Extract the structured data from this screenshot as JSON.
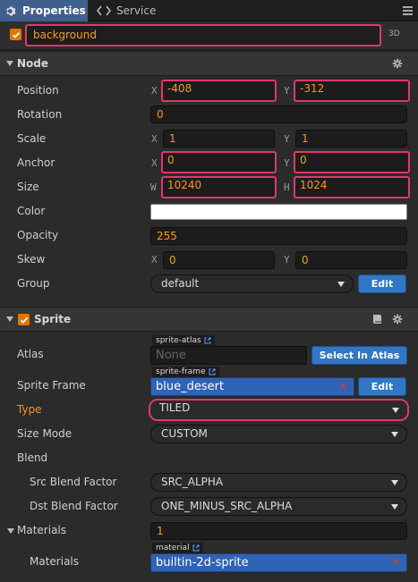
{
  "tabs": [
    {
      "label": "Properties",
      "icon": "gear-icon",
      "active": true
    },
    {
      "label": "Service",
      "icon": "code-icon",
      "active": false
    }
  ],
  "node": {
    "name": "background",
    "enabled": true,
    "mode_3d": "3D"
  },
  "node_section": {
    "title": "Node",
    "position": {
      "label": "Position",
      "x_axis": "X",
      "x": "-408",
      "y_axis": "Y",
      "y": "-312"
    },
    "rotation": {
      "label": "Rotation",
      "value": "0"
    },
    "scale": {
      "label": "Scale",
      "x_axis": "X",
      "x": "1",
      "y_axis": "Y",
      "y": "1"
    },
    "anchor": {
      "label": "Anchor",
      "x_axis": "X",
      "x": "0",
      "y_axis": "Y",
      "y": "0"
    },
    "size": {
      "label": "Size",
      "w_axis": "W",
      "w": "10240",
      "h_axis": "H",
      "h": "1024"
    },
    "color": {
      "label": "Color",
      "value": "#ffffff"
    },
    "opacity": {
      "label": "Opacity",
      "value": "255"
    },
    "skew": {
      "label": "Skew",
      "x_axis": "X",
      "x": "0",
      "y_axis": "Y",
      "y": "0"
    },
    "group": {
      "label": "Group",
      "value": "default",
      "edit_label": "Edit"
    }
  },
  "sprite_section": {
    "title": "Sprite",
    "enabled": true,
    "atlas": {
      "label": "Atlas",
      "tag": "sprite-atlas",
      "value": "None",
      "button": "Select In Atlas"
    },
    "sprite_frame": {
      "label": "Sprite Frame",
      "tag": "sprite-frame",
      "value": "blue_desert",
      "edit_label": "Edit"
    },
    "type": {
      "label": "Type",
      "value": "TILED"
    },
    "size_mode": {
      "label": "Size Mode",
      "value": "CUSTOM"
    },
    "blend": {
      "label": "Blend"
    },
    "src_blend": {
      "label": "Src Blend Factor",
      "value": "SRC_ALPHA"
    },
    "dst_blend": {
      "label": "Dst Blend Factor",
      "value": "ONE_MINUS_SRC_ALPHA"
    },
    "materials": {
      "label": "Materials",
      "count": "1",
      "item_label": "Materials",
      "tag": "material",
      "value": "builtin-2d-sprite"
    }
  },
  "colors": {
    "accent": "#f59a23",
    "highlight": "#e0376d",
    "button": "#3077c6",
    "asset": "#2f63b5"
  }
}
